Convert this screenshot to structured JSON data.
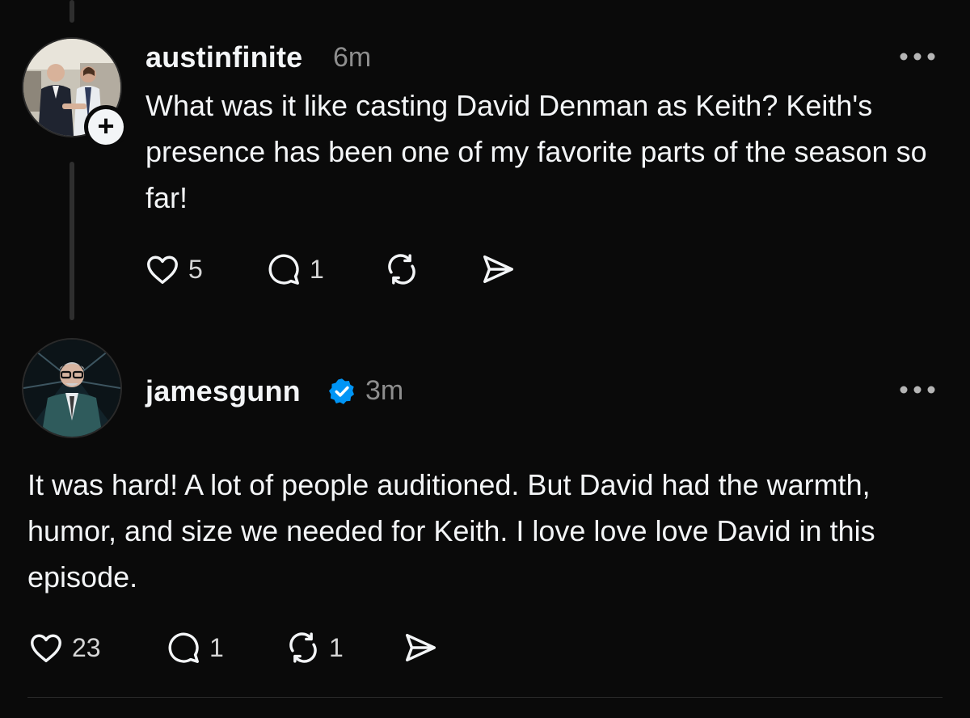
{
  "posts": [
    {
      "username": "austinfinite",
      "time": "6m",
      "text": "What was it like casting David Denman as Keith? Keith's presence has been one of my favorite parts of the season so far!",
      "likes": "5",
      "replies": "1",
      "reposts": "",
      "follow_glyph": "+"
    },
    {
      "username": "jamesgunn",
      "verified": true,
      "time": "3m",
      "text": "It was hard! A lot of people auditioned. But David had the warmth, humor, and size we needed for Keith. I love love love David in this episode.",
      "likes": "23",
      "replies": "1",
      "reposts": "1"
    }
  ],
  "colors": {
    "background": "#0a0a0a",
    "text": "#f3f5f7",
    "muted": "#8e8e8e",
    "verified": "#0095f6",
    "thread_line": "#2e2e2e"
  },
  "icons": [
    "heart-icon",
    "comment-icon",
    "repost-icon",
    "share-icon",
    "more-icon",
    "verified-badge-icon",
    "plus-icon"
  ]
}
